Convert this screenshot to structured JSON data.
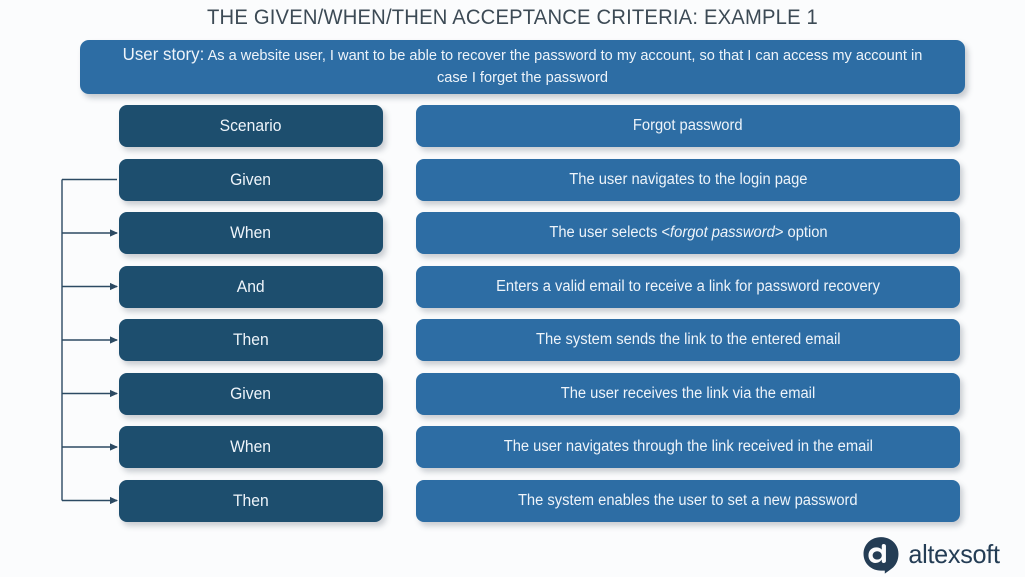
{
  "title": "THE GIVEN/WHEN/THEN ACCEPTANCE CRITERIA: EXAMPLE 1",
  "user_story": {
    "lead": "User story:",
    "text": " As a website user, I want to be able to recover the password to my account, so that I can access my account in case I forget the password"
  },
  "colors": {
    "background": "#fbfcfd",
    "left_box": "#1d4e6e",
    "right_box": "#2d6da4",
    "title_text": "#3c4a55",
    "box_text": "#eef4fa",
    "connector": "#2c4a63",
    "logo": "#243d55"
  },
  "rows": [
    {
      "keyword": "Scenario",
      "statement": "Forgot password",
      "statement_pre": "Forgot password",
      "statement_em": "",
      "statement_post": "",
      "has_connector": false
    },
    {
      "keyword": "Given",
      "statement": "The user navigates to the login page",
      "statement_pre": "The user navigates to the login page",
      "statement_em": "",
      "statement_post": "",
      "has_connector": true
    },
    {
      "keyword": "When",
      "statement": "The user selects <forgot password> option",
      "statement_pre": "The user selects <",
      "statement_em": "forgot password",
      "statement_post": "> option",
      "has_connector": true
    },
    {
      "keyword": "And",
      "statement": "Enters a valid email to receive a link for password recovery",
      "statement_pre": "Enters a valid email to receive a link for password recovery",
      "statement_em": "",
      "statement_post": "",
      "has_connector": true
    },
    {
      "keyword": "Then",
      "statement": "The system sends the link to the entered email",
      "statement_pre": "The system sends the link to the entered email",
      "statement_em": "",
      "statement_post": "",
      "has_connector": true
    },
    {
      "keyword": "Given",
      "statement": "The user receives the link via the email",
      "statement_pre": "The user receives the link via the email",
      "statement_em": "",
      "statement_post": "",
      "has_connector": true
    },
    {
      "keyword": "When",
      "statement": "The user navigates through the link received in the email",
      "statement_pre": "The user navigates through the link received in the email",
      "statement_em": "",
      "statement_post": "",
      "has_connector": true
    },
    {
      "keyword": "Then",
      "statement": "The system enables the user to set a new password",
      "statement_pre": "The system enables the user to set a new password",
      "statement_em": "",
      "statement_post": "",
      "has_connector": true
    }
  ],
  "logo": {
    "name": "altexsoft",
    "mark": "altexsoft-speech-bubble-icon"
  }
}
